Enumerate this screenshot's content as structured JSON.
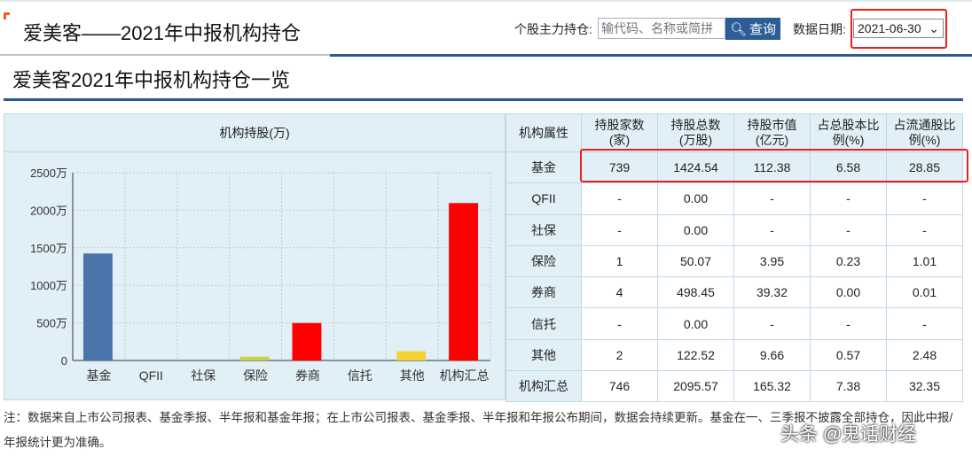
{
  "header": {
    "title": "爱美客——2021年中报机构持仓",
    "search_label": "个股主力持仓:",
    "search_placeholder": "输代码、名称或简拼",
    "search_button": "查询",
    "date_label": "数据日期:",
    "date_value": "2021-06-30"
  },
  "subtitle": "爱美客2021年中报机构持仓一览",
  "panel_title": "机构持股(万)",
  "chart_data": {
    "type": "bar",
    "title": "机构持股(万)",
    "categories": [
      "基金",
      "QFII",
      "社保",
      "保险",
      "券商",
      "信托",
      "其他",
      "机构汇总"
    ],
    "values": [
      1424.54,
      0,
      0,
      50.07,
      498.45,
      0,
      122.52,
      2095.57
    ],
    "colors": [
      "#4a75aa",
      "#4a75aa",
      "#4a75aa",
      "#c8d34a",
      "#ff0000",
      "#4a75aa",
      "#f5d230",
      "#ff0000"
    ],
    "ylim": [
      0,
      2500
    ],
    "yticks": [
      "0",
      "500万",
      "1000万",
      "1500万",
      "2000万",
      "2500万"
    ],
    "grid": true
  },
  "table": {
    "headers": [
      "机构属性",
      "持股家数(家)",
      "持股总数(万股)",
      "持股市值(亿元)",
      "占总股本比例(%)",
      "占流通股比例(%)"
    ],
    "rows": [
      [
        "基金",
        "739",
        "1424.54",
        "112.38",
        "6.58",
        "28.85"
      ],
      [
        "QFII",
        "-",
        "0.00",
        "-",
        "-",
        "-"
      ],
      [
        "社保",
        "-",
        "0.00",
        "-",
        "-",
        "-"
      ],
      [
        "保险",
        "1",
        "50.07",
        "3.95",
        "0.23",
        "1.01"
      ],
      [
        "券商",
        "4",
        "498.45",
        "39.32",
        "0.00",
        "0.01"
      ],
      [
        "信托",
        "-",
        "0.00",
        "-",
        "-",
        "-"
      ],
      [
        "其他",
        "2",
        "122.52",
        "9.66",
        "0.57",
        "2.48"
      ],
      [
        "机构汇总",
        "746",
        "2095.57",
        "165.32",
        "7.38",
        "32.35"
      ]
    ]
  },
  "note": "注：数据来自上市公司报表、基金季报、半年报和基金年报；在上市公司报表、基金季报、半年报和年报公布期间，数据会持续更新。基金在一、三季报不披露全部持仓，因此中报/年报统计更为准确。",
  "watermark": "头条 @鬼话财经"
}
